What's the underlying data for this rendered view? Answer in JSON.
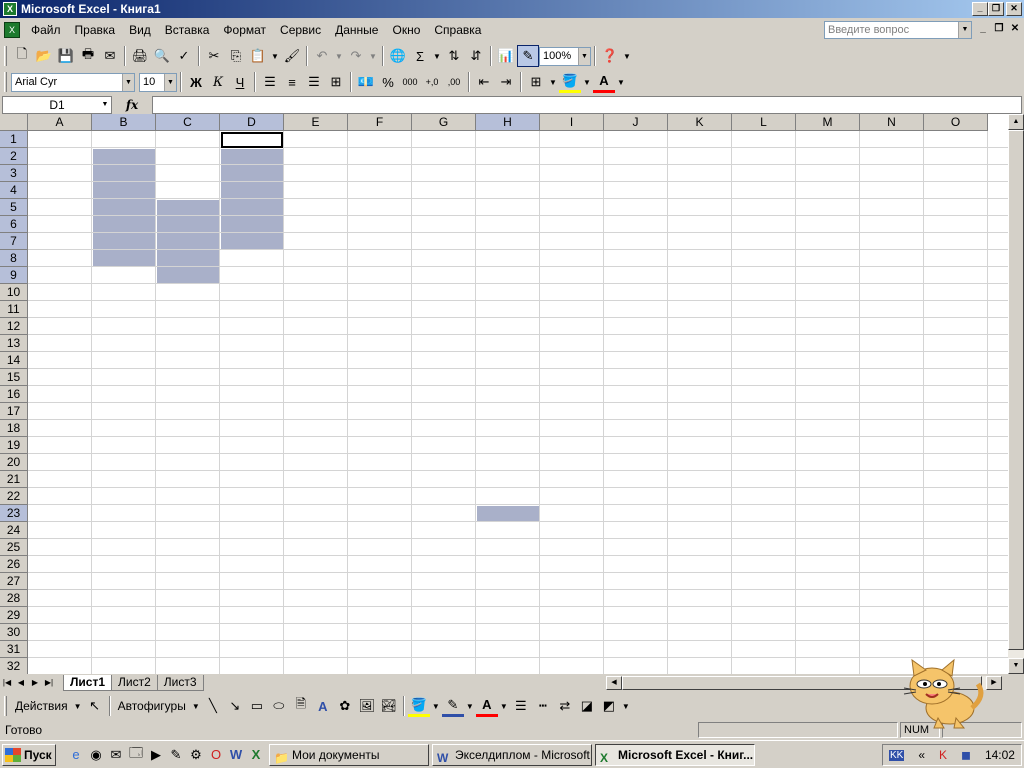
{
  "window": {
    "title": "Microsoft Excel - Книга1"
  },
  "menu": {
    "items": [
      "Файл",
      "Правка",
      "Вид",
      "Вставка",
      "Формат",
      "Сервис",
      "Данные",
      "Окно",
      "Справка"
    ],
    "ask_placeholder": "Введите вопрос"
  },
  "toolbar_standard": {
    "zoom": "100%"
  },
  "toolbar_format": {
    "font_name": "Arial Cyr",
    "font_size": "10",
    "bold": "Ж",
    "italic": "К",
    "underline": "Ч",
    "percent": "%",
    "thousands": "000"
  },
  "formula_bar": {
    "name_box": "D1",
    "fx": "fx",
    "value": ""
  },
  "grid": {
    "columns": [
      "A",
      "B",
      "C",
      "D",
      "E",
      "F",
      "G",
      "H",
      "I",
      "J",
      "K",
      "L",
      "M",
      "N",
      "O"
    ],
    "rows": [
      "1",
      "2",
      "3",
      "4",
      "5",
      "6",
      "7",
      "8",
      "9",
      "10",
      "11",
      "12",
      "13",
      "14",
      "15",
      "16",
      "17",
      "18",
      "19",
      "20",
      "21",
      "22",
      "23",
      "24",
      "25",
      "26",
      "27",
      "28",
      "29",
      "30",
      "31",
      "32"
    ],
    "selected_columns": [
      "B",
      "C",
      "D",
      "H"
    ],
    "selected_rows": [
      "1",
      "2",
      "3",
      "4",
      "5",
      "6",
      "7",
      "8",
      "9",
      "23"
    ],
    "selection_color": "#a9b0c9",
    "active_cell": "D1",
    "selected_ranges": [
      "B2:B8",
      "C5:C9",
      "D2:D7",
      "H23"
    ]
  },
  "sheets": {
    "tabs": [
      "Лист1",
      "Лист2",
      "Лист3"
    ],
    "active": "Лист1"
  },
  "drawing_toolbar": {
    "actions": "Действия",
    "autoshapes": "Автофигуры"
  },
  "status": {
    "text": "Готово",
    "num": "NUM"
  },
  "taskbar": {
    "start": "Пуск",
    "tasks": [
      "Мои документы",
      "Экселдиплом - Microsoft...",
      "Microsoft Excel - Книг..."
    ],
    "active_task": 2,
    "clock": "14:02",
    "lang": "KK"
  }
}
